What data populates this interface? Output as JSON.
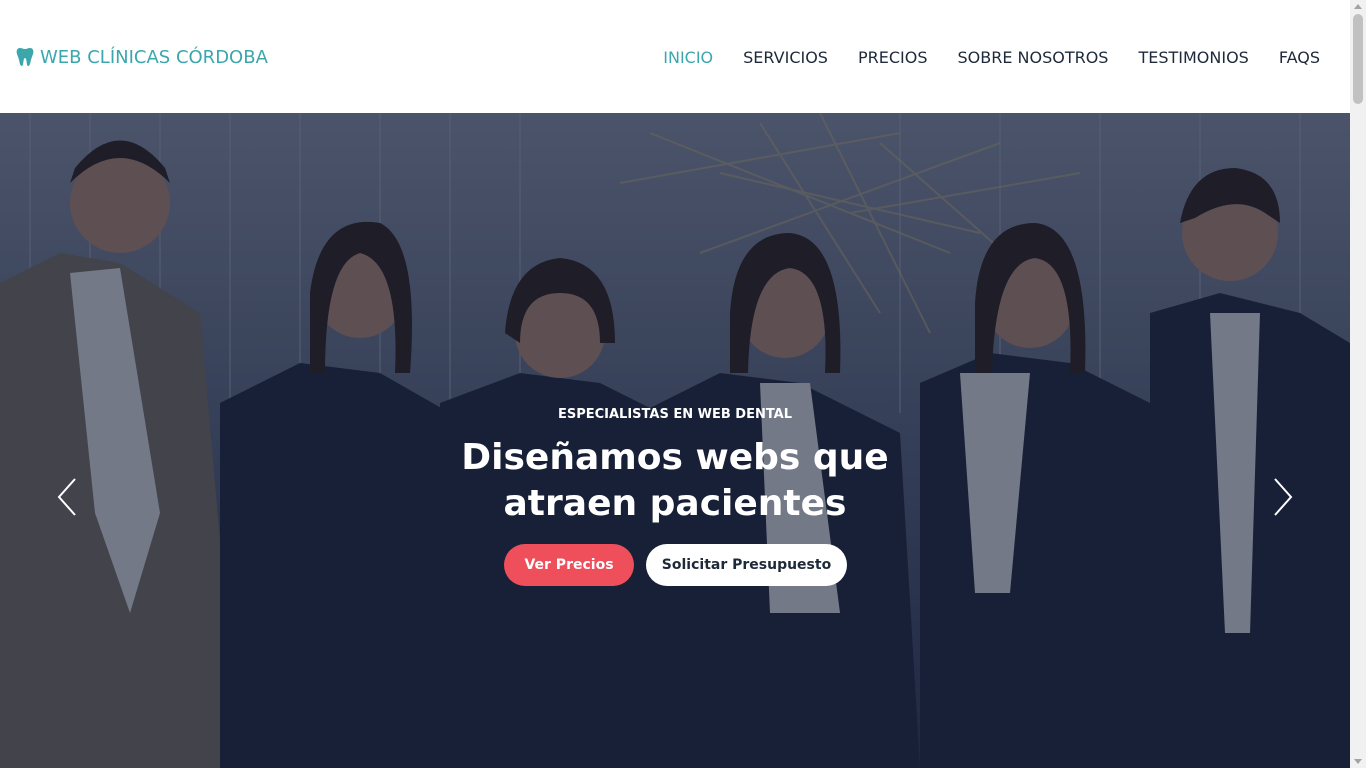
{
  "brand": {
    "name": "WEB CLÍNICAS CÓRDOBA",
    "icon": "tooth-icon",
    "color": "#3ba7ad"
  },
  "nav": {
    "items": [
      {
        "label": "INICIO",
        "active": true
      },
      {
        "label": "SERVICIOS",
        "active": false
      },
      {
        "label": "PRECIOS",
        "active": false
      },
      {
        "label": "SOBRE NOSOTROS",
        "active": false
      },
      {
        "label": "TESTIMONIOS",
        "active": false
      },
      {
        "label": "FAQS",
        "active": false
      }
    ]
  },
  "hero": {
    "eyebrow": "ESPECIALISTAS EN WEB DENTAL",
    "headline": "Diseñamos webs que atraen pacientes",
    "primary_button": "Ver Precios",
    "secondary_button": "Solicitar Presupuesto",
    "prev_icon": "chevron-left-icon",
    "next_icon": "chevron-right-icon"
  },
  "colors": {
    "accent": "#3ba7ad",
    "primary_button": "#ef4f5b",
    "nav_text": "#1e2a3a",
    "overlay": "#1e2a44"
  }
}
